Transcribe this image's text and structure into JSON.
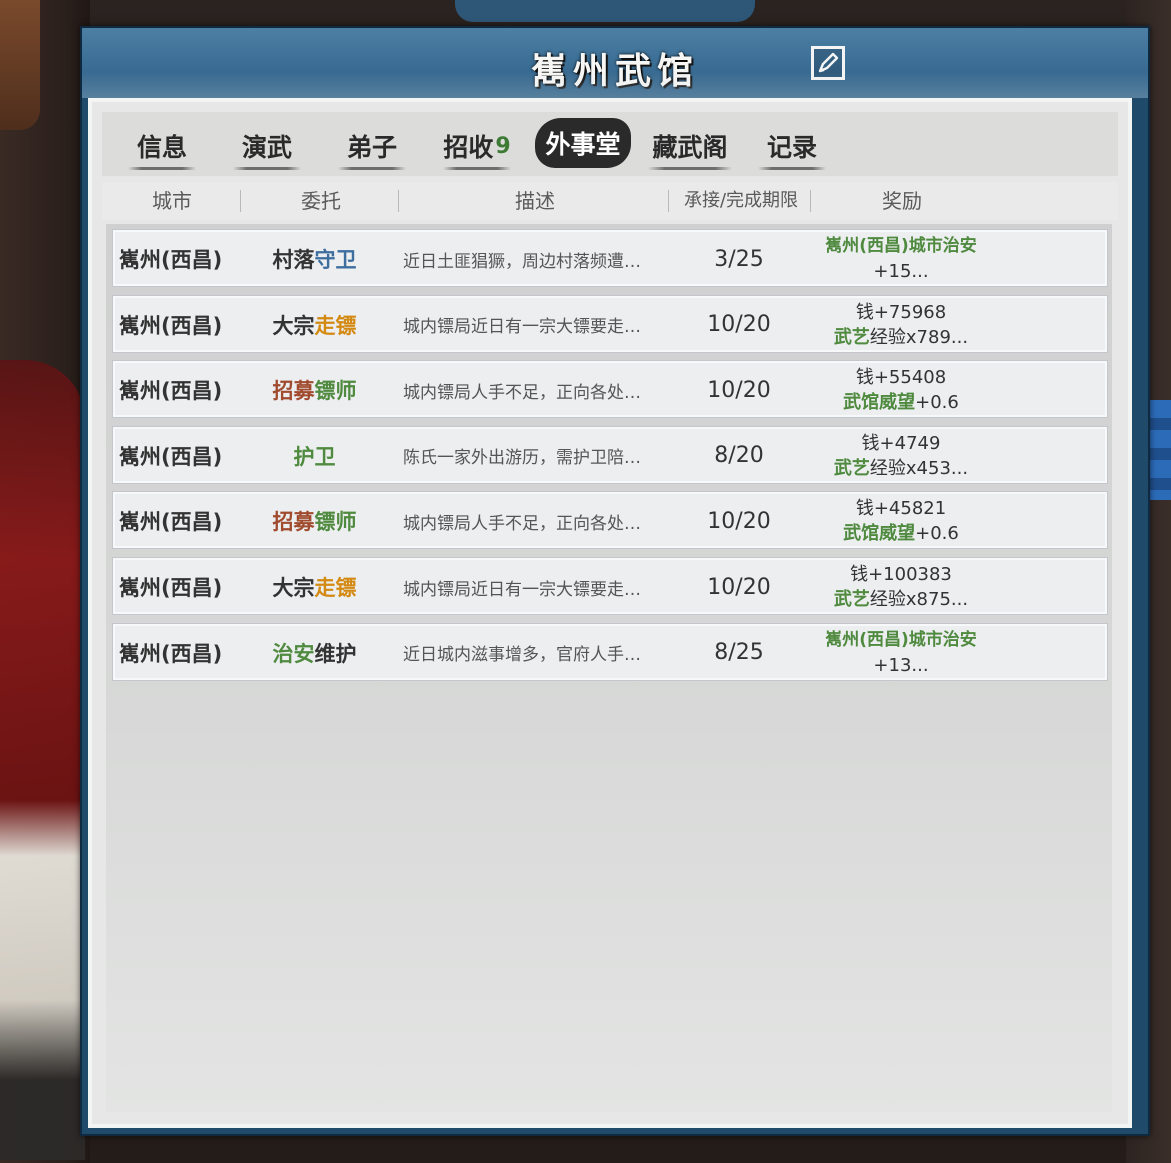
{
  "window": {
    "title": "嶲州武馆"
  },
  "tabs": [
    {
      "label": "信息",
      "active": false
    },
    {
      "label": "演武",
      "active": false
    },
    {
      "label": "弟子",
      "active": false
    },
    {
      "label": "招收",
      "badge": "9",
      "active": false
    },
    {
      "label": "外事堂",
      "active": true
    },
    {
      "label": "藏武阁",
      "active": false
    },
    {
      "label": "记录",
      "active": false
    }
  ],
  "columns": [
    "城市",
    "委托",
    "描述",
    "承接/完成期限",
    "奖励"
  ],
  "rows": [
    {
      "city": "嶲州(西昌)",
      "task": [
        [
          "村落",
          "dk"
        ],
        [
          "守卫",
          "bl"
        ]
      ],
      "desc": "近日土匪猖獗，周边村落频遭…",
      "limit": "3/25",
      "reward": [
        {
          "text": "嶲州(西昌)城市治安",
          "cls": "rw-green rw-small"
        },
        {
          "text": "+15...",
          "cls": ""
        }
      ]
    },
    {
      "city": "嶲州(西昌)",
      "task": [
        [
          "大宗",
          "dk"
        ],
        [
          "走镖",
          "yw"
        ]
      ],
      "desc": "城内镖局近日有一宗大镖要走…",
      "limit": "10/20",
      "reward": [
        {
          "text": "钱+75968",
          "cls": ""
        },
        {
          "parts": [
            [
              "武艺",
              "rw-green"
            ],
            [
              "经验x789...",
              ""
            ]
          ]
        }
      ]
    },
    {
      "city": "嶲州(西昌)",
      "task": [
        [
          "招募",
          "rd"
        ],
        [
          "镖师",
          "gn"
        ]
      ],
      "desc": "城内镖局人手不足，正向各处…",
      "limit": "10/20",
      "reward": [
        {
          "text": "钱+55408",
          "cls": ""
        },
        {
          "parts": [
            [
              "武馆威望",
              "rw-green"
            ],
            [
              "+0.6",
              ""
            ]
          ]
        }
      ]
    },
    {
      "city": "嶲州(西昌)",
      "task": [
        [
          "护卫",
          "gn"
        ]
      ],
      "desc": "陈氏一家外出游历，需护卫陪…",
      "limit": "8/20",
      "reward": [
        {
          "text": "钱+4749",
          "cls": ""
        },
        {
          "parts": [
            [
              "武艺",
              "rw-green"
            ],
            [
              "经验x453...",
              ""
            ]
          ]
        }
      ]
    },
    {
      "city": "嶲州(西昌)",
      "task": [
        [
          "招募",
          "rd"
        ],
        [
          "镖师",
          "gn"
        ]
      ],
      "desc": "城内镖局人手不足，正向各处…",
      "limit": "10/20",
      "reward": [
        {
          "text": "钱+45821",
          "cls": ""
        },
        {
          "parts": [
            [
              "武馆威望",
              "rw-green"
            ],
            [
              "+0.6",
              ""
            ]
          ]
        }
      ]
    },
    {
      "city": "嶲州(西昌)",
      "task": [
        [
          "大宗",
          "dk"
        ],
        [
          "走镖",
          "yw"
        ]
      ],
      "desc": "城内镖局近日有一宗大镖要走…",
      "limit": "10/20",
      "reward": [
        {
          "text": "钱+100383",
          "cls": ""
        },
        {
          "parts": [
            [
              "武艺",
              "rw-green"
            ],
            [
              "经验x875...",
              ""
            ]
          ]
        }
      ]
    },
    {
      "city": "嶲州(西昌)",
      "task": [
        [
          "治安",
          "gn"
        ],
        [
          "维护",
          "dk"
        ]
      ],
      "desc": "近日城内滋事增多，官府人手…",
      "limit": "8/25",
      "reward": [
        {
          "text": "嶲州(西昌)城市治安",
          "cls": "rw-green rw-small"
        },
        {
          "text": "+13...",
          "cls": ""
        }
      ]
    }
  ],
  "icons": {
    "edit": "edit-icon"
  },
  "colors": {
    "header": "#3c6f96",
    "activeTab": "#2a2a2a",
    "greenText": "#4f8a3f",
    "yellowText": "#d48a12",
    "blueText": "#3d6e9e",
    "redText": "#a04a2e"
  }
}
